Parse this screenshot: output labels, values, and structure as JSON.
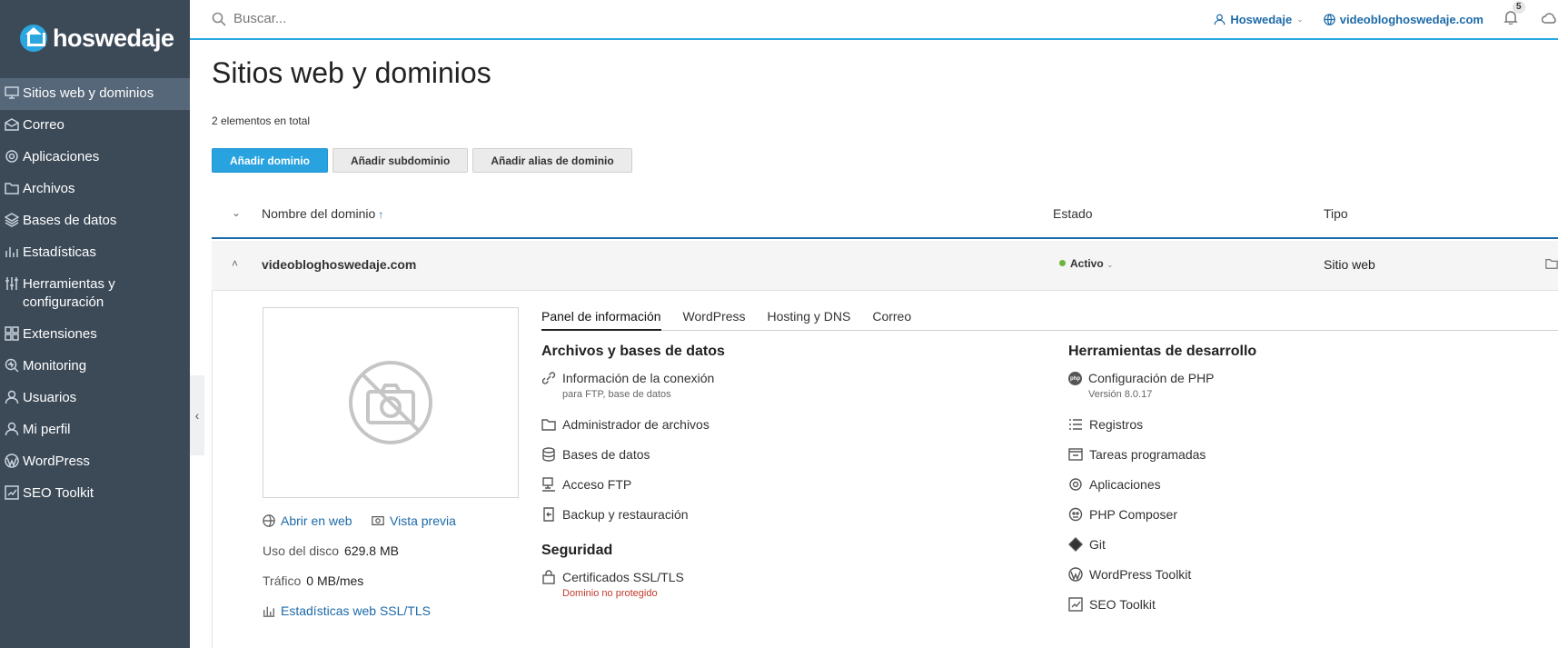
{
  "brand": {
    "name": "hoswedaje"
  },
  "sidebar": {
    "items": [
      {
        "label": "Sitios web y dominios",
        "icon": "monitor-icon",
        "active": true
      },
      {
        "label": "Correo",
        "icon": "mail-icon"
      },
      {
        "label": "Aplicaciones",
        "icon": "gear-icon"
      },
      {
        "label": "Archivos",
        "icon": "folder-icon"
      },
      {
        "label": "Bases de datos",
        "icon": "database-icon"
      },
      {
        "label": "Estadísticas",
        "icon": "bar-chart-icon"
      },
      {
        "label": "Herramientas y configuración",
        "icon": "sliders-icon"
      },
      {
        "label": "Extensiones",
        "icon": "grid-icon"
      },
      {
        "label": "Monitoring",
        "icon": "monitoring-icon"
      },
      {
        "label": "Usuarios",
        "icon": "user-icon"
      },
      {
        "label": "Mi perfil",
        "icon": "profile-icon"
      },
      {
        "label": "WordPress",
        "icon": "wordpress-icon"
      },
      {
        "label": "SEO Toolkit",
        "icon": "seo-icon"
      }
    ]
  },
  "topbar": {
    "search_placeholder": "Buscar...",
    "user": "Hoswedaje",
    "domain": "videobloghoswedaje.com",
    "notifications": "5"
  },
  "page": {
    "title": "Sitios web y dominios",
    "count": "2 elementos en total",
    "buttons": {
      "add_domain": "Añadir dominio",
      "add_subdomain": "Añadir subdominio",
      "add_alias": "Añadir alias de dominio"
    }
  },
  "table": {
    "headers": {
      "name": "Nombre del dominio",
      "sort": "↑",
      "status": "Estado",
      "type": "Tipo"
    },
    "row": {
      "domain": "videobloghoswedaje.com",
      "status": "Activo",
      "type": "Sitio web"
    }
  },
  "detail": {
    "links": {
      "open_web": "Abrir en web",
      "preview": "Vista previa",
      "disk_label": "Uso del disco",
      "disk_value": "629.8 MB",
      "traffic_label": "Tráfico",
      "traffic_value": "0 MB/mes",
      "ssl_stats": "Estadísticas web SSL/TLS"
    },
    "tabs": [
      "Panel de información",
      "WordPress",
      "Hosting y DNS",
      "Correo"
    ],
    "files_section": {
      "title": "Archivos y bases de datos",
      "items": [
        {
          "label": "Información de la conexión",
          "sub": "para FTP, base de datos"
        },
        {
          "label": "Administrador de archivos"
        },
        {
          "label": "Bases de datos"
        },
        {
          "label": "Acceso FTP"
        },
        {
          "label": "Backup y restauración"
        }
      ]
    },
    "security_section": {
      "title": "Seguridad",
      "items": [
        {
          "label": "Certificados SSL/TLS",
          "sub": "Dominio no protegido"
        }
      ]
    },
    "dev_section": {
      "title": "Herramientas de desarrollo",
      "php_badge": "php",
      "items": [
        {
          "label": "Configuración de PHP",
          "sub": "Versión 8.0.17"
        },
        {
          "label": "Registros"
        },
        {
          "label": "Tareas programadas"
        },
        {
          "label": "Aplicaciones"
        },
        {
          "label": "PHP Composer"
        },
        {
          "label": "Git"
        },
        {
          "label": "WordPress Toolkit"
        },
        {
          "label": "SEO Toolkit"
        }
      ]
    }
  },
  "colors": {
    "sidebar": "#3c4a58",
    "sidebar_active": "#56677a",
    "accent": "#29a3df",
    "link": "#1c6aa8",
    "status_ok": "#6db33f",
    "warning": "#c0392b"
  }
}
